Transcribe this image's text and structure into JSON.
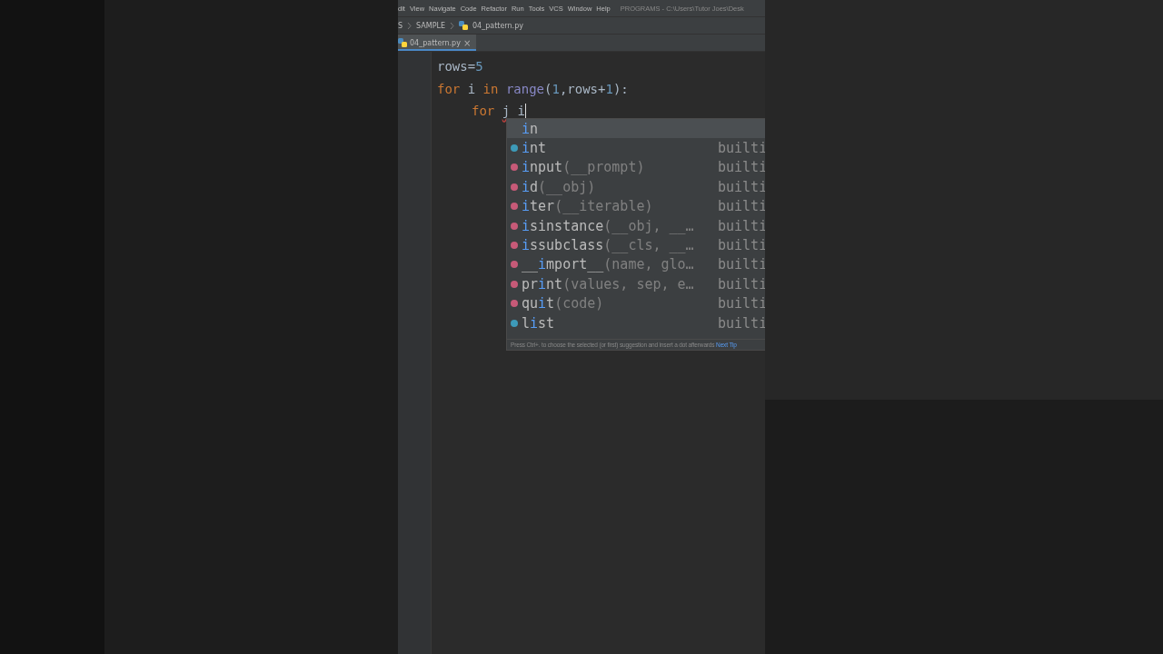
{
  "menu_bar": {
    "items": [
      "dit",
      "View",
      "Navigate",
      "Code",
      "Refactor",
      "Run",
      "Tools",
      "VCS",
      "Window",
      "Help"
    ],
    "title": "PROGRAMS - C:\\Users\\Tutor Joes\\Desk"
  },
  "breadcrumb": [
    "S",
    "SAMPLE",
    "04_pattern.py"
  ],
  "tabs": [
    {
      "label": "04_pattern.py",
      "selected": true,
      "close": "×"
    }
  ],
  "editor": {
    "lines": [
      {
        "indent": false,
        "tokens": [
          {
            "kind": "plain",
            "text": "rows="
          },
          {
            "kind": "number",
            "text": "5"
          }
        ]
      },
      {
        "indent": false,
        "tokens": [
          {
            "kind": "keyword",
            "text": "for"
          },
          {
            "kind": "plain",
            "text": " i "
          },
          {
            "kind": "keyword",
            "text": "in"
          },
          {
            "kind": "builtin",
            "text": " range"
          },
          {
            "kind": "plain",
            "text": "("
          },
          {
            "kind": "number",
            "text": "1"
          },
          {
            "kind": "plain",
            "text": ",rows+"
          },
          {
            "kind": "number",
            "text": "1"
          },
          {
            "kind": "plain",
            "text": "):"
          }
        ]
      },
      {
        "indent": true,
        "cursor": true,
        "tokens": [
          {
            "kind": "keyword",
            "text": "for "
          },
          {
            "kind": "error",
            "text": "j i"
          }
        ]
      }
    ]
  },
  "completion": {
    "items": [
      {
        "kind": "keyword",
        "selected": true,
        "match": "i",
        "after": "n"
      },
      {
        "kind": "class",
        "selected": false,
        "match": "i",
        "after": "nt",
        "source": "builti"
      },
      {
        "kind": "function",
        "selected": false,
        "match": "i",
        "after": "nput",
        "params": "(__prompt)",
        "source": "builti"
      },
      {
        "kind": "function",
        "selected": false,
        "match": "i",
        "after": "d",
        "params": "(__obj)",
        "source": "builti"
      },
      {
        "kind": "function",
        "selected": false,
        "match": "i",
        "after": "ter",
        "params": "(__iterable)",
        "source": "builti"
      },
      {
        "kind": "function",
        "selected": false,
        "match": "i",
        "after": "sinstance",
        "params": "(__obj, __…",
        "source": "builti"
      },
      {
        "kind": "function",
        "selected": false,
        "match": "i",
        "after": "ssubclass",
        "params": "(__cls, __…",
        "source": "builti"
      },
      {
        "kind": "function",
        "selected": false,
        "before": "__",
        "match": "i",
        "after": "mport__",
        "params": "(name, glo…",
        "source": "builti"
      },
      {
        "kind": "function",
        "selected": false,
        "before": "pr",
        "match": "i",
        "after": "nt",
        "params": "(values, sep, e…",
        "source": "builti"
      },
      {
        "kind": "function",
        "selected": false,
        "before": "qu",
        "match": "i",
        "after": "t",
        "params": "(code)",
        "source": "builti"
      },
      {
        "kind": "class",
        "selected": false,
        "before": "l",
        "match": "i",
        "after": "st",
        "source": "builti"
      }
    ],
    "hint": "Press Ctrl+. to choose the selected (or first) suggestion and insert a dot afterwards",
    "hint_link": "Next Tip"
  }
}
